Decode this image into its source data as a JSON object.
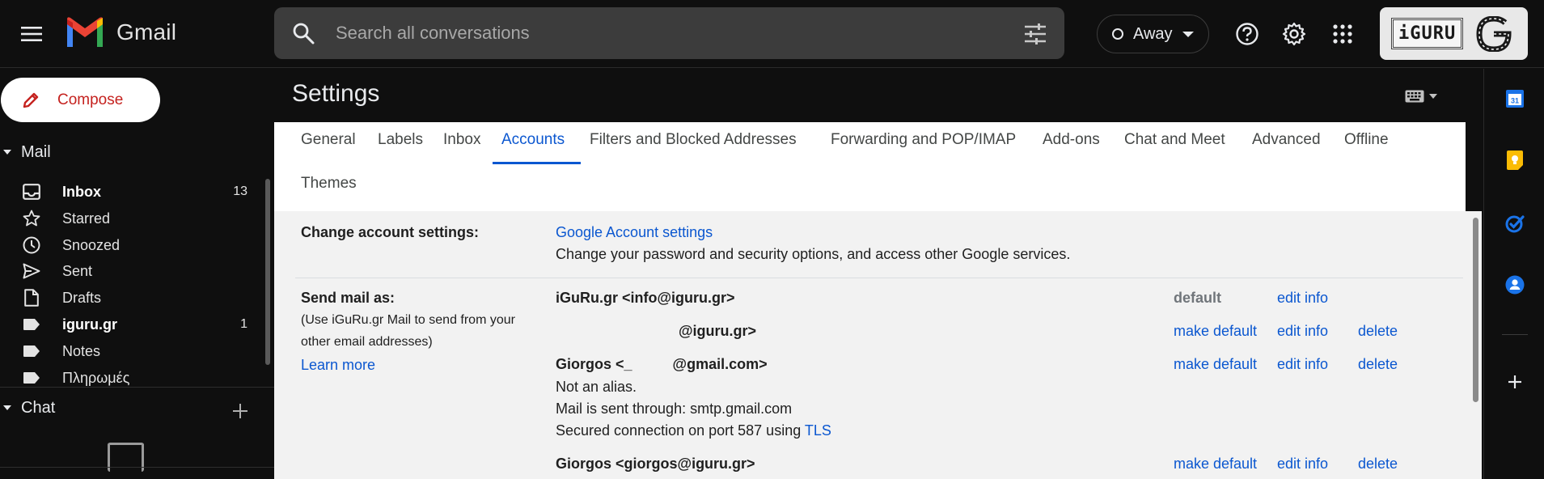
{
  "app": {
    "name": "Gmail"
  },
  "search": {
    "placeholder": "Search all conversations"
  },
  "status": {
    "label": "Away"
  },
  "account": {
    "logo_text": "iGURU"
  },
  "compose": {
    "label": "Compose"
  },
  "nav": {
    "mail_label": "Mail",
    "items": [
      {
        "label": "Inbox",
        "count": "13",
        "icon": "inbox-icon",
        "bold": true
      },
      {
        "label": "Starred",
        "count": "",
        "icon": "star-icon",
        "bold": false
      },
      {
        "label": "Snoozed",
        "count": "",
        "icon": "clock-icon",
        "bold": false
      },
      {
        "label": "Sent",
        "count": "",
        "icon": "send-icon",
        "bold": false
      },
      {
        "label": "Drafts",
        "count": "",
        "icon": "draft-icon",
        "bold": false
      },
      {
        "label": "iguru.gr",
        "count": "1",
        "icon": "label-icon",
        "bold": true
      },
      {
        "label": "Notes",
        "count": "",
        "icon": "label-icon",
        "bold": false
      },
      {
        "label": "Πληρωμές",
        "count": "",
        "icon": "label-icon",
        "bold": false
      }
    ],
    "chat_label": "Chat"
  },
  "settings": {
    "title": "Settings",
    "tabs": [
      {
        "label": "General"
      },
      {
        "label": "Labels"
      },
      {
        "label": "Inbox"
      },
      {
        "label": "Accounts"
      },
      {
        "label": "Filters and Blocked Addresses"
      },
      {
        "label": "Forwarding and POP/IMAP"
      },
      {
        "label": "Add-ons"
      },
      {
        "label": "Chat and Meet"
      },
      {
        "label": "Advanced"
      },
      {
        "label": "Offline"
      },
      {
        "label": "Themes"
      }
    ],
    "active_tab": "Accounts",
    "change_account": {
      "label": "Change account settings:",
      "link": "Google Account settings",
      "desc": "Change your password and security options, and access other Google services."
    },
    "send_mail_as": {
      "label": "Send mail as:",
      "note_line1": "(Use iGuRu.gr Mail to send from your",
      "note_line2": "other email addresses)",
      "learn_more": "Learn more",
      "entries": [
        {
          "name": "iGuRu.gr <info@iguru.gr>"
        },
        {
          "name": "@iguru.gr>"
        },
        {
          "name": "Giorgos <_          @gmail.com>",
          "details": [
            "Not an alias.",
            "Mail is sent through: smtp.gmail.com"
          ],
          "secured_prefix": "Secured connection on port 587 using ",
          "secured_link": "TLS"
        },
        {
          "name": "Giorgos <giorgos@iguru.gr>"
        }
      ],
      "default_label": "default",
      "make_default": "make default",
      "edit_info": "edit info",
      "delete": "delete"
    }
  },
  "colors": {
    "accent": "#0b57d0",
    "compose_text": "#c5221f",
    "background": "#0f0f0f"
  }
}
